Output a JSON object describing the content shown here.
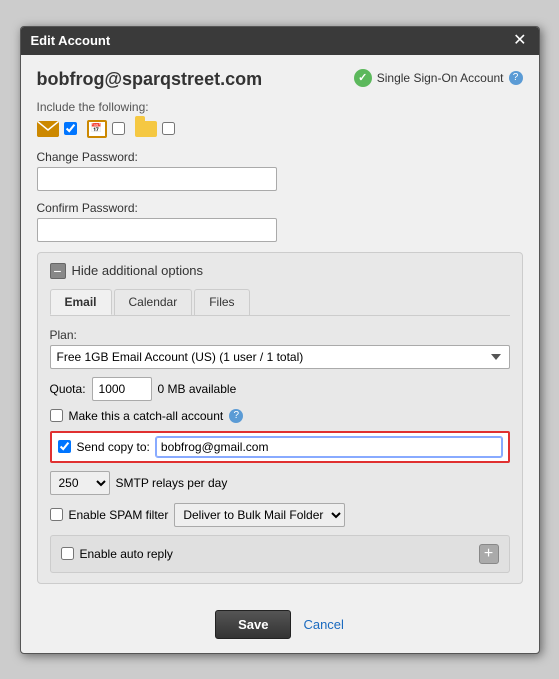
{
  "modal": {
    "title": "Edit Account",
    "close_label": "✕"
  },
  "account": {
    "email": "bobfrog@sparqstreet.com",
    "sso_label": "Single Sign-On Account",
    "sso_help": "?",
    "include_label": "Include the following:"
  },
  "form": {
    "change_password_label": "Change Password:",
    "confirm_password_label": "Confirm Password:",
    "change_password_value": "",
    "confirm_password_value": ""
  },
  "additional_options": {
    "hide_label": "Hide additional options",
    "minus": "−"
  },
  "tabs": [
    {
      "label": "Email",
      "active": true
    },
    {
      "label": "Calendar",
      "active": false
    },
    {
      "label": "Files",
      "active": false
    }
  ],
  "plan": {
    "label": "Plan:",
    "value": "Free 1GB Email Account (US) (1 user / 1 total)"
  },
  "quota": {
    "label": "Quota:",
    "value": "1000",
    "available": "0 MB available"
  },
  "catch_all": {
    "label": "Make this a catch-all account",
    "help": "?"
  },
  "send_copy": {
    "label": "Send copy to:",
    "value": "bobfrog@gmail.com"
  },
  "smtp": {
    "value": "250",
    "label": "SMTP relays per day"
  },
  "spam": {
    "checkbox_label": "Enable SPAM filter",
    "select_value": "Deliver to Bulk Mail Folder"
  },
  "auto_reply": {
    "label": "Enable auto reply",
    "plus": "+"
  },
  "footer": {
    "save_label": "Save",
    "cancel_label": "Cancel"
  }
}
